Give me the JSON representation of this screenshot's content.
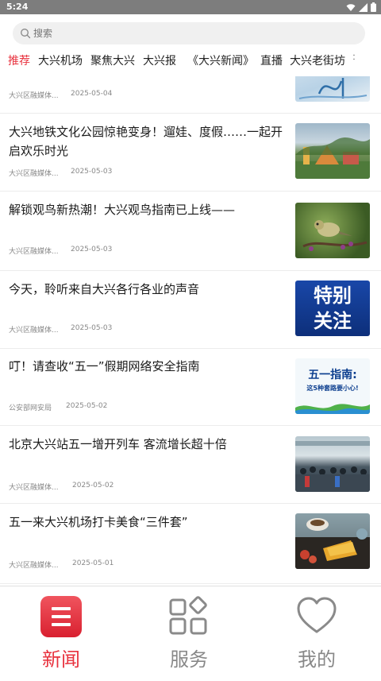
{
  "status_bar": {
    "time": "5:24"
  },
  "search": {
    "placeholder": "搜索"
  },
  "tabs": [
    {
      "label": "推荐",
      "active": true
    },
    {
      "label": "大兴机场",
      "active": false
    },
    {
      "label": "聚焦大兴",
      "active": false
    },
    {
      "label": "大兴报",
      "active": false
    },
    {
      "label": "《大兴新闻》",
      "active": false
    },
    {
      "label": "直播",
      "active": false
    },
    {
      "label": "大兴老街坊",
      "active": false
    }
  ],
  "articles": [
    {
      "title": "",
      "source": "大兴区融媒体...",
      "date": "2025-05-04"
    },
    {
      "title": "大兴地铁文化公园惊艳变身！遛娃、度假……一起开启欢乐时光",
      "source": "大兴区融媒体...",
      "date": "2025-05-03"
    },
    {
      "title": "解锁观鸟新热潮！大兴观鸟指南已上线——",
      "source": "大兴区融媒体...",
      "date": "2025-05-03"
    },
    {
      "title": "今天，聆听来自大兴各行各业的声音",
      "source": "大兴区融媒体...",
      "date": "2025-05-03",
      "thumb_text": [
        "特别",
        "关注"
      ]
    },
    {
      "title": "叮！请查收“五一”假期网络安全指南",
      "source": "公安部网安局",
      "date": "2025-05-02",
      "thumb_text": [
        "五一指南:",
        "这5种套路要小心!"
      ]
    },
    {
      "title": "北京大兴站五一增开列车 客流增长超十倍",
      "source": "大兴区融媒体...",
      "date": "2025-05-02"
    },
    {
      "title": "五一来大兴机场打卡美食“三件套”",
      "source": "大兴区融媒体...",
      "date": "2025-05-01"
    }
  ],
  "bottom_nav": [
    {
      "label": "新闻",
      "icon": "news-icon",
      "active": true
    },
    {
      "label": "服务",
      "icon": "services-grid-icon",
      "active": false
    },
    {
      "label": "我的",
      "icon": "heart-icon",
      "active": false
    }
  ],
  "colors": {
    "accent": "#e8323e",
    "inactive": "#888888",
    "status_bar": "#7d7d7d"
  }
}
